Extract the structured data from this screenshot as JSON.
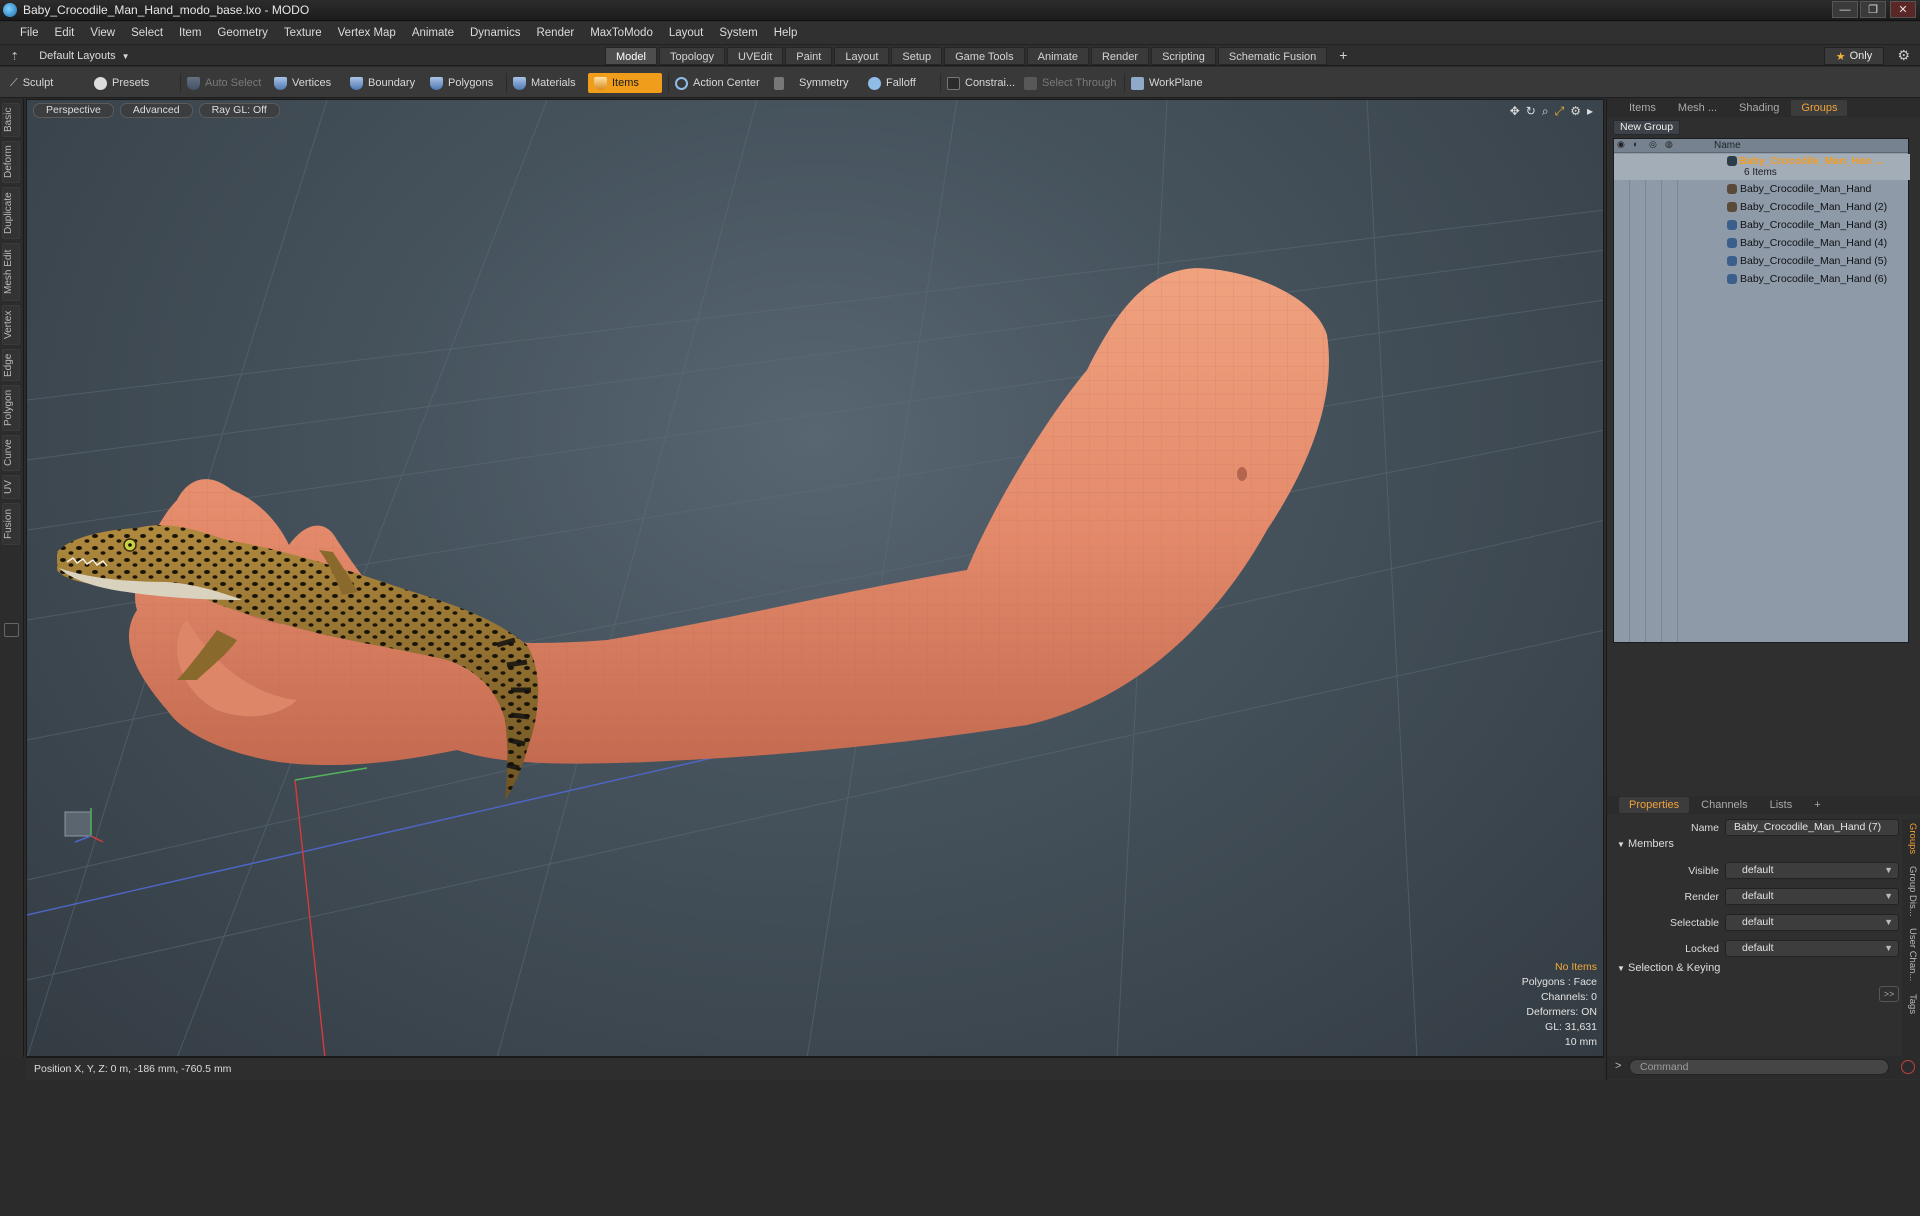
{
  "window": {
    "title": "Baby_Crocodile_Man_Hand_modo_base.lxo - MODO",
    "controls": [
      "—",
      "❐",
      "✕"
    ]
  },
  "menu": [
    "File",
    "Edit",
    "View",
    "Select",
    "Item",
    "Geometry",
    "Texture",
    "Vertex Map",
    "Animate",
    "Dynamics",
    "Render",
    "MaxToModo",
    "Layout",
    "System",
    "Help"
  ],
  "layout_bar": {
    "layouts_dropdown": "Default Layouts",
    "tabs": [
      "Model",
      "Topology",
      "UVEdit",
      "Paint",
      "Layout",
      "Setup",
      "Game Tools",
      "Animate",
      "Render",
      "Scripting",
      "Schematic Fusion"
    ],
    "active_tab": "Model",
    "add_tab": "+",
    "only_label": "Only"
  },
  "toolbar": {
    "sculpt": "Sculpt",
    "presets": "Presets",
    "auto_select": "Auto Select",
    "vertices": "Vertices",
    "boundary": "Boundary",
    "polygons": "Polygons",
    "materials": "Materials",
    "items": "Items",
    "action_center": "Action Center",
    "symmetry": "Symmetry",
    "falloff": "Falloff",
    "constraints": "Constrai...",
    "select_through": "Select Through",
    "workplane": "WorkPlane"
  },
  "left_tabs": [
    "Basic",
    "Deform",
    "Duplicate",
    "Mesh Edit",
    "Vertex",
    "Edge",
    "Polygon",
    "Curve",
    "UV",
    "Fusion"
  ],
  "viewport": {
    "view_mode": "Perspective",
    "shading": "Advanced",
    "raygl": "Ray GL: Off",
    "info": {
      "no_items": "No Items",
      "polygons": "Polygons : Face",
      "channels": "Channels: 0",
      "deformers": "Deformers: ON",
      "gl": "GL: 31,631",
      "scale": "10 mm"
    }
  },
  "status": {
    "position": "Position X, Y, Z:  0 m, -186 mm, -760.5 mm"
  },
  "panel_tabs": [
    "Items",
    "Mesh ...",
    "Shading",
    "Groups"
  ],
  "panel_active_tab": "Groups",
  "groups": {
    "new_group": "New Group",
    "col_name": "Name",
    "parent": "Baby_Crocodile_Man_Han ...",
    "parent_count": "6 Items",
    "children": [
      "Baby_Crocodile_Man_Hand",
      "Baby_Crocodile_Man_Hand (2)",
      "Baby_Crocodile_Man_Hand (3)",
      "Baby_Crocodile_Man_Hand (4)",
      "Baby_Crocodile_Man_Hand (5)",
      "Baby_Crocodile_Man_Hand (6)"
    ]
  },
  "properties_tabs": [
    "Properties",
    "Channels",
    "Lists",
    "+"
  ],
  "properties": {
    "name_label": "Name",
    "name_value": "Baby_Crocodile_Man_Hand (7)",
    "members": "Members",
    "visible_label": "Visible",
    "visible_value": "default",
    "render_label": "Render",
    "render_value": "default",
    "selectable_label": "Selectable",
    "selectable_value": "default",
    "locked_label": "Locked",
    "locked_value": "default",
    "selection_keying": "Selection & Keying",
    "more": ">>"
  },
  "side_strip_tabs": [
    "Groups",
    "Group Dis...",
    "User Chan...",
    "Tags"
  ],
  "command_placeholder": "Command",
  "colors": {
    "accent": "#f09d1c",
    "skin": "#e3896a",
    "viewport_bg": "#45525c"
  }
}
